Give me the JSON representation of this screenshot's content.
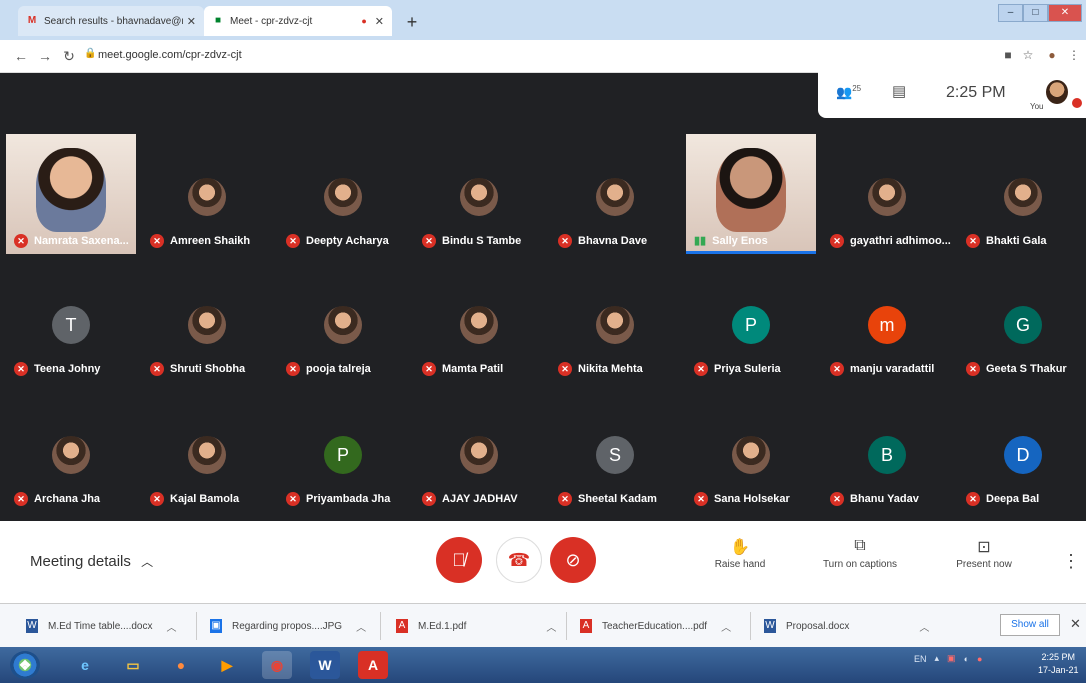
{
  "browser": {
    "tabs": [
      {
        "label": "Search results - bhavnadave@m",
        "icon": "gmail-icon",
        "active": false
      },
      {
        "label": "Meet - cpr-zdvz-cjt",
        "icon": "meet-icon",
        "active": true
      }
    ],
    "url": "meet.google.com/cpr-zdvz-cjt"
  },
  "meet": {
    "participant_count": "25",
    "time": "2:25 PM",
    "you_label": "You",
    "participants": [
      {
        "name": "Namrata Saxena...",
        "avatar": "video",
        "letter": "",
        "color": ""
      },
      {
        "name": "Amreen Shaikh",
        "avatar": "photo",
        "letter": "",
        "color": ""
      },
      {
        "name": "Deepty Acharya",
        "avatar": "photo",
        "letter": "",
        "color": ""
      },
      {
        "name": "Bindu S Tambe",
        "avatar": "photo",
        "letter": "",
        "color": ""
      },
      {
        "name": "Bhavna Dave",
        "avatar": "photo",
        "letter": "",
        "color": ""
      },
      {
        "name": "Sally Enos",
        "avatar": "video",
        "letter": "",
        "color": "",
        "speaking": true
      },
      {
        "name": "gayathri adhimoo...",
        "avatar": "photo",
        "letter": "",
        "color": ""
      },
      {
        "name": "Bhakti Gala",
        "avatar": "photo",
        "letter": "",
        "color": ""
      },
      {
        "name": "Teena Johny",
        "avatar": "letter",
        "letter": "T",
        "color": "#5f6368"
      },
      {
        "name": "Shruti Shobha",
        "avatar": "photo",
        "letter": "",
        "color": ""
      },
      {
        "name": "pooja talreja",
        "avatar": "photo",
        "letter": "",
        "color": ""
      },
      {
        "name": "Mamta Patil",
        "avatar": "photo",
        "letter": "",
        "color": ""
      },
      {
        "name": "Nikita Mehta",
        "avatar": "photo",
        "letter": "",
        "color": ""
      },
      {
        "name": "Priya Suleria",
        "avatar": "letter",
        "letter": "P",
        "color": "#00897b"
      },
      {
        "name": "manju varadattil",
        "avatar": "letter",
        "letter": "m",
        "color": "#e8430b"
      },
      {
        "name": "Geeta S Thakur",
        "avatar": "letter",
        "letter": "G",
        "color": "#00695c"
      },
      {
        "name": "Archana Jha",
        "avatar": "photo",
        "letter": "",
        "color": ""
      },
      {
        "name": "Kajal Bamola",
        "avatar": "photo",
        "letter": "",
        "color": ""
      },
      {
        "name": "Priyambada Jha",
        "avatar": "letter",
        "letter": "P",
        "color": "#33691e"
      },
      {
        "name": "AJAY JADHAV",
        "avatar": "photo",
        "letter": "",
        "color": ""
      },
      {
        "name": "Sheetal Kadam",
        "avatar": "letter",
        "letter": "S",
        "color": "#5f6368"
      },
      {
        "name": "Sana Holsekar",
        "avatar": "photo",
        "letter": "",
        "color": ""
      },
      {
        "name": "Bhanu Yadav",
        "avatar": "letter",
        "letter": "B",
        "color": "#00695c"
      },
      {
        "name": "Deepa Bal",
        "avatar": "letter",
        "letter": "D",
        "color": "#1565c0"
      }
    ],
    "controls": {
      "meeting_details": "Meeting details",
      "raise_hand": "Raise hand",
      "captions": "Turn on captions",
      "present": "Present now"
    }
  },
  "downloads": {
    "items": [
      {
        "name": "M.Ed Time table....docx",
        "icon": "word-doc-icon",
        "color": "#2b579a"
      },
      {
        "name": "Regarding propos....JPG",
        "icon": "image-icon",
        "color": "#1a73e8"
      },
      {
        "name": "M.Ed.1.pdf",
        "icon": "pdf-icon",
        "color": "#d93025"
      },
      {
        "name": "TeacherEducation....pdf",
        "icon": "pdf-icon",
        "color": "#d93025"
      },
      {
        "name": "Proposal.docx",
        "icon": "word-doc-icon",
        "color": "#2b579a"
      }
    ],
    "show_all": "Show all"
  },
  "taskbar": {
    "lang": "EN",
    "time": "2:25 PM",
    "date": "17-Jan-21"
  }
}
